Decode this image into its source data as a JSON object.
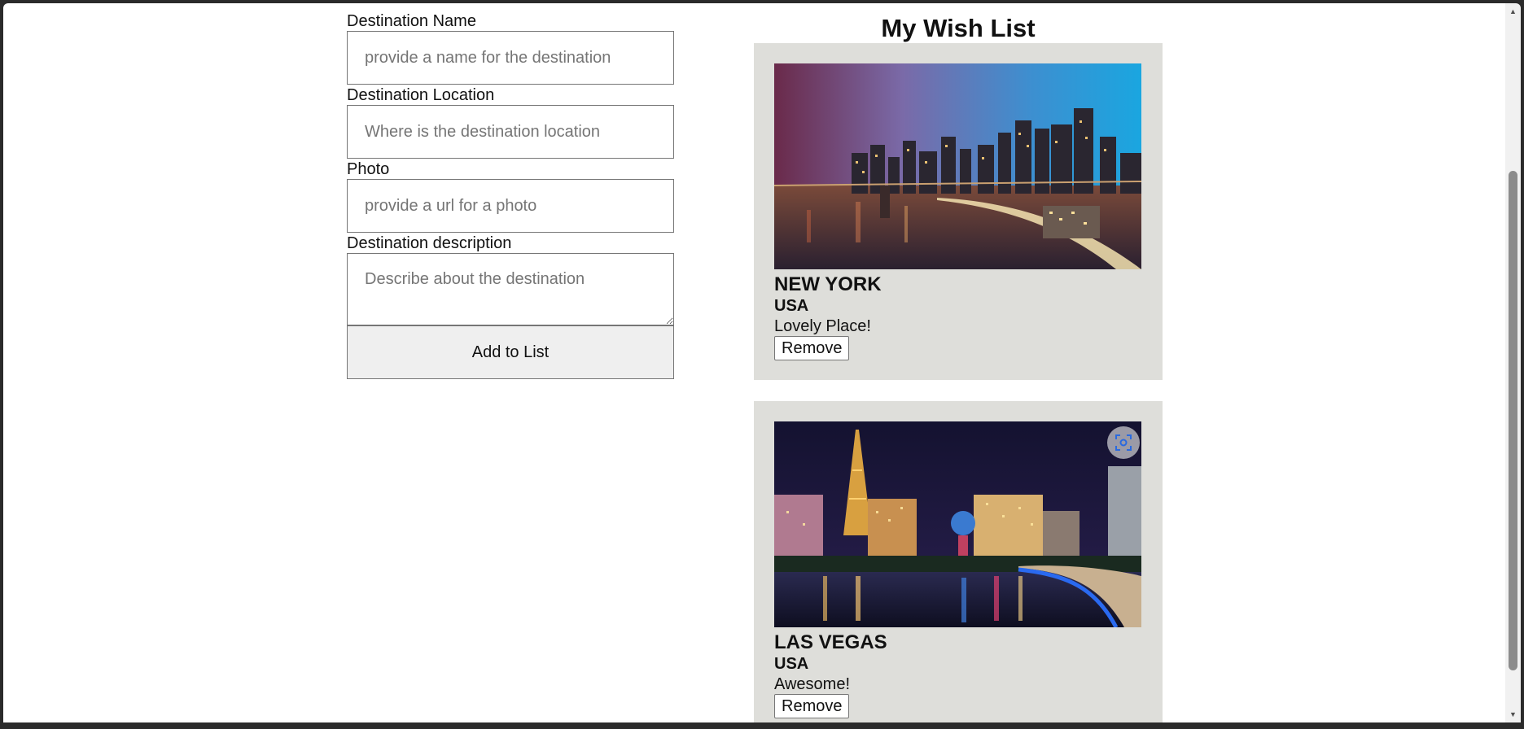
{
  "form": {
    "name_label": "Destination Name",
    "name_placeholder": "provide a name for the destination",
    "location_label": "Destination Location",
    "location_placeholder": "Where is the destination location",
    "photo_label": "Photo",
    "photo_placeholder": "provide a url for a photo",
    "description_label": "Destination description",
    "description_placeholder": "Describe about the destination",
    "submit_label": "Add to List"
  },
  "wishlist": {
    "title": "My Wish List",
    "cards": [
      {
        "name": "NEW YORK",
        "location": "USA",
        "description": "Lovely Place!",
        "remove_label": "Remove"
      },
      {
        "name": "LAS VEGAS",
        "location": "USA",
        "description": "Awesome!",
        "remove_label": "Remove"
      }
    ]
  },
  "icons": {
    "image_search": "lens-icon"
  },
  "colors": {
    "card_background": "#dededa",
    "button_background": "#efefef"
  }
}
